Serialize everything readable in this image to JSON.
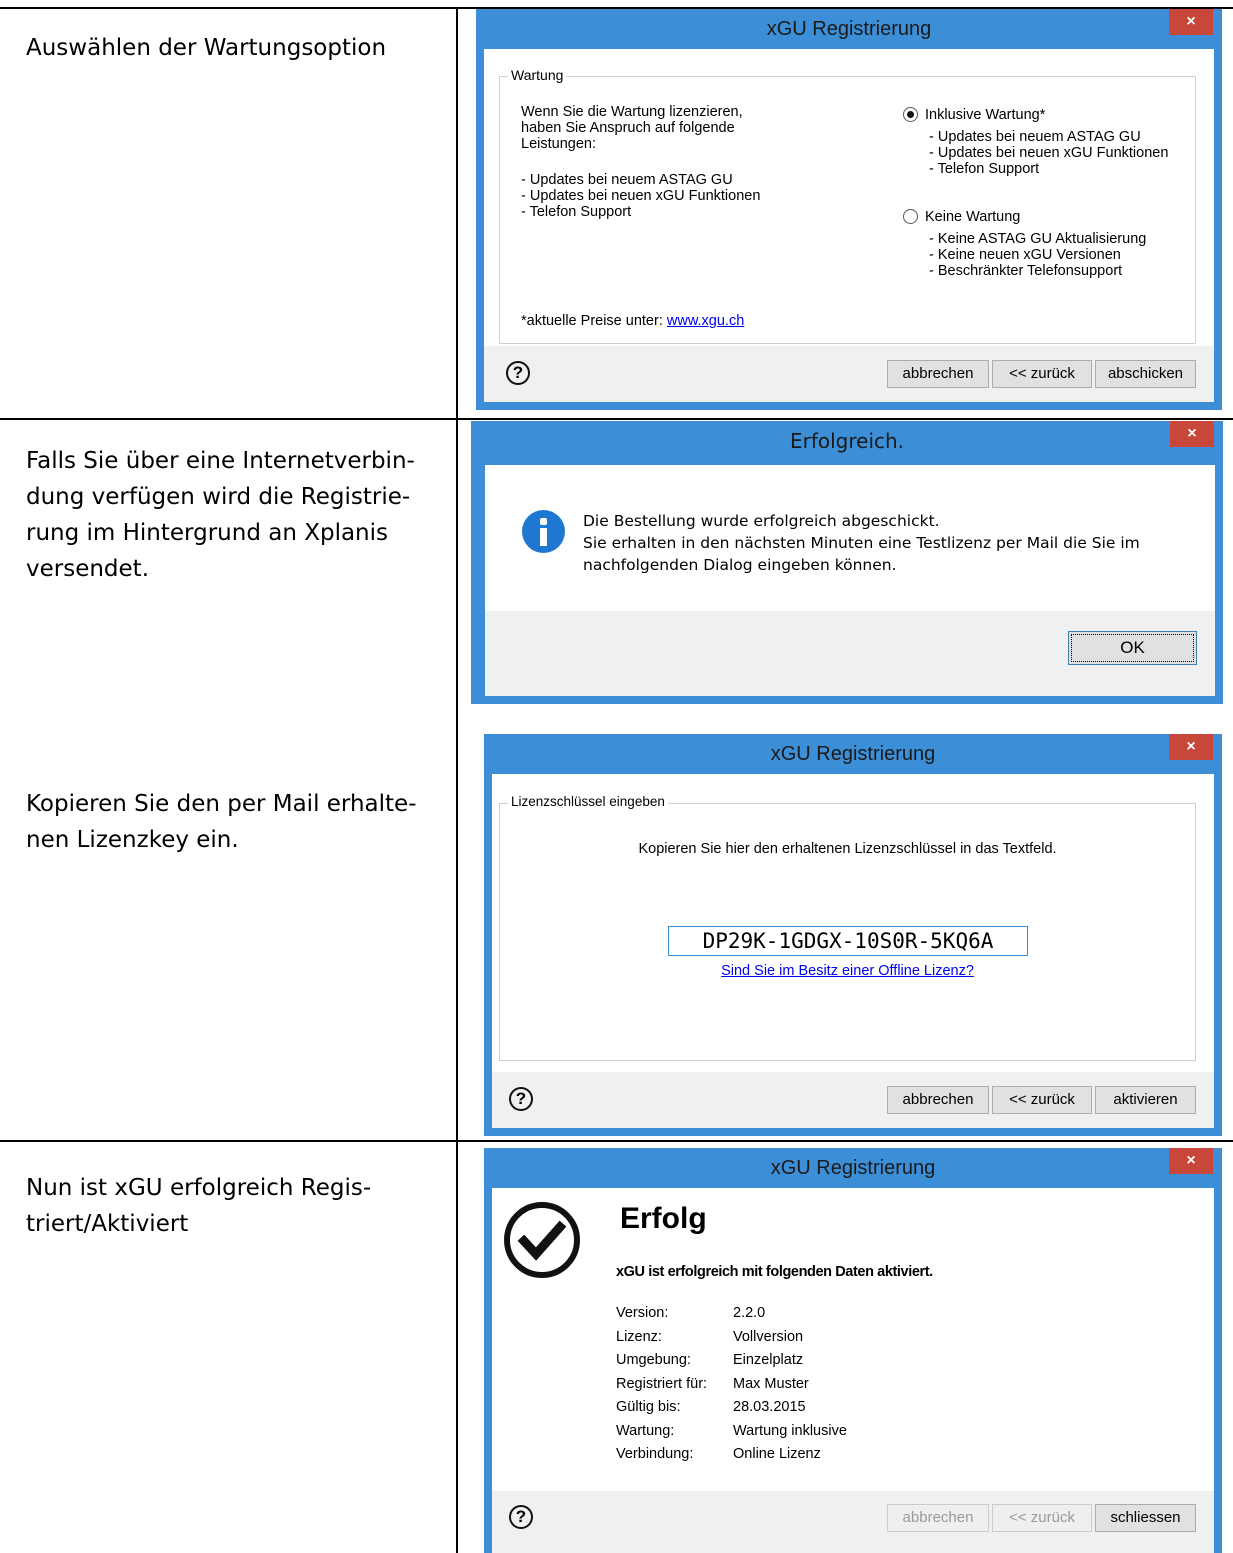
{
  "rows": [
    {
      "description": "Auswählen der Wartungsoption"
    },
    {
      "description": "Falls Sie über eine Internetverbin-\ndung verfügen wird die Registrie-\nrung im Hintergrund an Xplanis\nversendet."
    },
    {
      "description": "Kopieren Sie den per Mail erhalte-\nnen Lizenzkey ein."
    },
    {
      "description": "Nun ist xGU erfolgreich Regis-\ntriert/Aktiviert"
    }
  ],
  "close_glyph": "×",
  "help_glyph": "?",
  "dialog1": {
    "title": "xGU Registrierung",
    "group_label": "Wartung",
    "info_text": "Wenn Sie die Wartung lizenzieren,\nhaben Sie Anspruch auf folgende\nLeistungen:",
    "info_list": "- Updates bei neuem ASTAG GU\n- Updates bei neuen xGU Funktionen\n- Telefon Support",
    "option1_label": "Inklusive Wartung*",
    "option1_selected": true,
    "option1_list": "- Updates bei neuem ASTAG GU\n- Updates bei neuen xGU Funktionen\n- Telefon Support",
    "option2_label": "Keine Wartung",
    "option2_selected": false,
    "option2_list": "- Keine ASTAG GU Aktualisierung\n- Keine neuen xGU Versionen\n- Beschränkter Telefonsupport",
    "price_text": "*aktuelle Preise unter: ",
    "price_link": "www.xgu.ch",
    "btn_cancel": "abbrechen",
    "btn_back": "<< zurück",
    "btn_submit": "abschicken"
  },
  "dialog2": {
    "title": "Erfolgreich.",
    "message": "Die Bestellung wurde erfolgreich abgeschickt.\nSie erhalten in den nächsten Minuten eine Testlizenz per Mail die Sie im\nnachfolgenden Dialog eingeben können.",
    "btn_ok": "OK"
  },
  "dialog3": {
    "title": "xGU Registrierung",
    "group_label": "Lizenzschlüssel eingeben",
    "instruction": "Kopieren Sie hier den erhaltenen Lizenzschlüssel in das Textfeld.",
    "license_key": "DP29K-1GDGX-10S0R-5KQ6A",
    "offline_link": "Sind Sie im Besitz einer Offline Lizenz?",
    "btn_cancel": "abbrechen",
    "btn_back": "<< zurück",
    "btn_activate": "aktivieren"
  },
  "dialog4": {
    "title": "xGU Registrierung",
    "heading": "Erfolg",
    "subheading": "xGU ist erfolgreich mit folgenden Daten aktiviert.",
    "details": [
      {
        "label": "Version:",
        "value": "2.2.0"
      },
      {
        "label": "Lizenz:",
        "value": "Vollversion"
      },
      {
        "label": "Umgebung:",
        "value": "Einzelplatz"
      },
      {
        "label": "Registriert für:",
        "value": "Max Muster"
      },
      {
        "label": "Gültig bis:",
        "value": "28.03.2015"
      },
      {
        "label": "Wartung:",
        "value": "Wartung inklusive"
      },
      {
        "label": "Verbindung:",
        "value": "Online Lizenz"
      }
    ],
    "btn_cancel": "abbrechen",
    "btn_back": "<< zurück",
    "btn_close": "schliessen"
  },
  "colors": {
    "window_frame": "#3c8fd7",
    "close_button": "#c9463a",
    "link": "#0000ee",
    "info_icon": "#1e78d2"
  }
}
